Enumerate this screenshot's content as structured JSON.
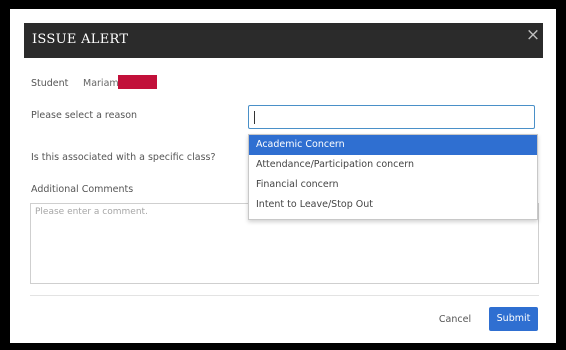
{
  "modal": {
    "title": "ISSUE ALERT",
    "close_glyph": "×"
  },
  "student": {
    "label": "Student",
    "name": "Mariam"
  },
  "reason": {
    "label": "Please select a reason",
    "value": "",
    "options": [
      "Academic Concern",
      "Attendance/Participation concern",
      "Financial concern",
      "Intent to Leave/Stop Out"
    ],
    "highlighted": "Academic Concern"
  },
  "class_question": {
    "label": "Is this associated with a specific class?"
  },
  "comments": {
    "label": "Additional Comments",
    "placeholder": "Please enter a comment."
  },
  "footer": {
    "cancel_label": "Cancel",
    "submit_label": "Submit"
  },
  "colors": {
    "header_bg": "#2b2b2b",
    "primary": "#2f6fd1",
    "redaction": "#c2103a",
    "focus_border": "#4a90c8"
  },
  "icons": {
    "close": "close-icon"
  }
}
